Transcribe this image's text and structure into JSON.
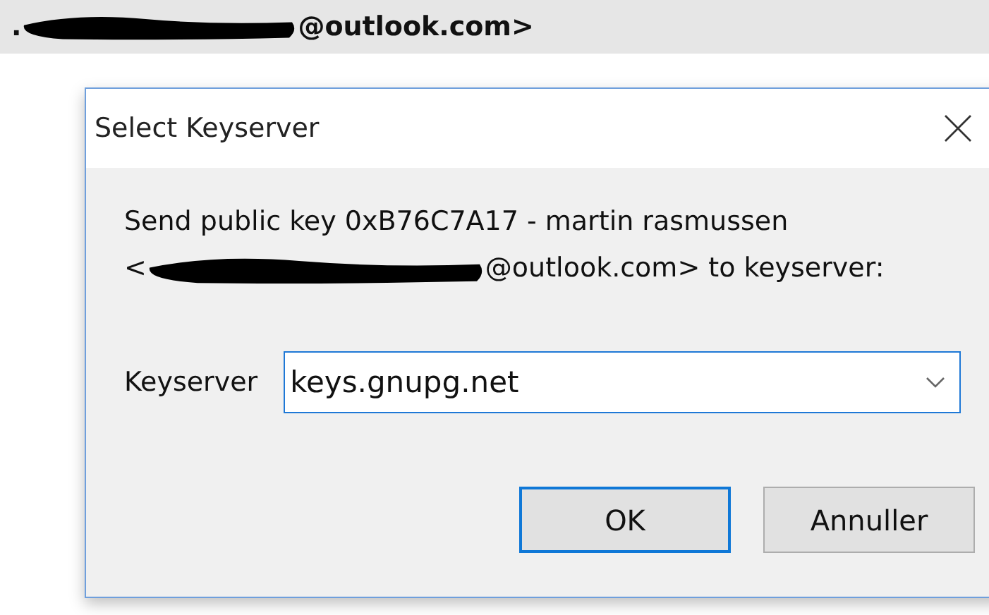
{
  "background_header": {
    "prefix": ".",
    "redacted": true,
    "text": "@outlook.com>"
  },
  "dialog": {
    "title": "Select Keyserver",
    "message": {
      "line_1": "Send public key 0xB76C7A17 - martin rasmussen",
      "line_2_start": "<",
      "redacted": true,
      "line_2_end": "@outlook.com> to keyserver:"
    },
    "keyserver": {
      "label": "Keyserver",
      "value": "keys.gnupg.net"
    },
    "buttons": [
      {
        "label": "OK",
        "default": true
      },
      {
        "label": "Annuller",
        "default": false
      }
    ]
  }
}
